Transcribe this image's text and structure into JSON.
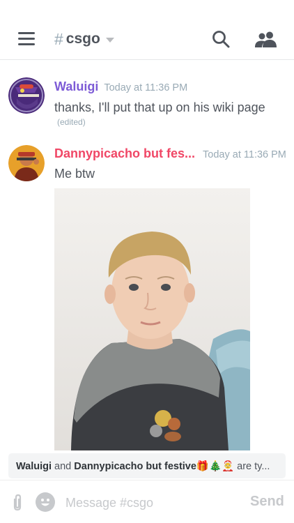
{
  "header": {
    "channel_hash": "#",
    "channel_name": "csgo"
  },
  "messages": [
    {
      "username": "Waluigi",
      "username_color": "#7d5bd6",
      "timestamp": "Today at 11:36 PM",
      "text": "thanks, I'll put that up on his wiki page",
      "edited_label": "(edited)"
    },
    {
      "username": "Dannypicacho but fes...",
      "username_color": "#f04766",
      "timestamp": "Today at 11:36 PM",
      "text": "Me btw",
      "attachment": "photo of a young blond boy in a grey and black shirt"
    }
  ],
  "typing": {
    "user1": "Waluigi",
    "joiner": "and",
    "user2": "Dannypicacho but festive🎁🎄🤶",
    "suffix": "are ty..."
  },
  "composer": {
    "placeholder": "Message #csgo",
    "send_label": "Send"
  },
  "icons": {
    "menu": "hamburger-icon",
    "search": "search-icon",
    "members": "members-icon",
    "attach": "paperclip-icon",
    "emoji": "emoji-icon"
  },
  "colors": {
    "accent_muted": "#99aab5",
    "text": "#4f545c",
    "disabled": "#c7c9cc"
  }
}
